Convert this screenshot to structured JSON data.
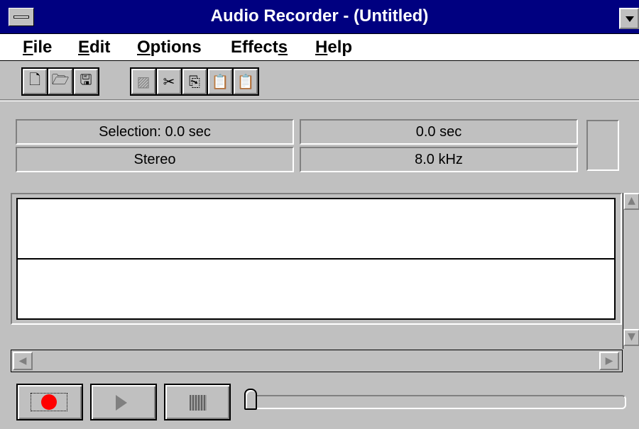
{
  "window": {
    "title": "Audio Recorder - (Untitled)",
    "system_menu_icon": "system-menu-icon",
    "minimize_icon": "minimize-icon"
  },
  "menu": [
    {
      "label": "File",
      "underline": "F",
      "rest": "ile"
    },
    {
      "label": "Edit",
      "underline": "E",
      "rest": "dit"
    },
    {
      "label": "Options",
      "underline": "O",
      "rest": "ptions"
    },
    {
      "label": "Effects",
      "pre": "Effect",
      "underline": "s",
      "rest": ""
    },
    {
      "label": "Help",
      "underline": "H",
      "rest": "elp"
    }
  ],
  "toolbar": {
    "file_group": [
      "new-icon",
      "open-icon",
      "save-icon"
    ],
    "edit_group": [
      "delete-icon",
      "cut-icon",
      "copy-icon",
      "paste-icon",
      "paste-mix-icon"
    ]
  },
  "status": {
    "selection": "Selection: 0.0 sec",
    "position": "0.0 sec",
    "channels": "Stereo",
    "sample_rate": "8.0 kHz"
  },
  "transport": {
    "record_icon": "record-icon",
    "play_icon": "play-icon",
    "stop_icon": "stop-icon",
    "record_color": "#ff0000"
  },
  "colors": {
    "titlebar": "#000080",
    "face": "#c0c0c0"
  }
}
